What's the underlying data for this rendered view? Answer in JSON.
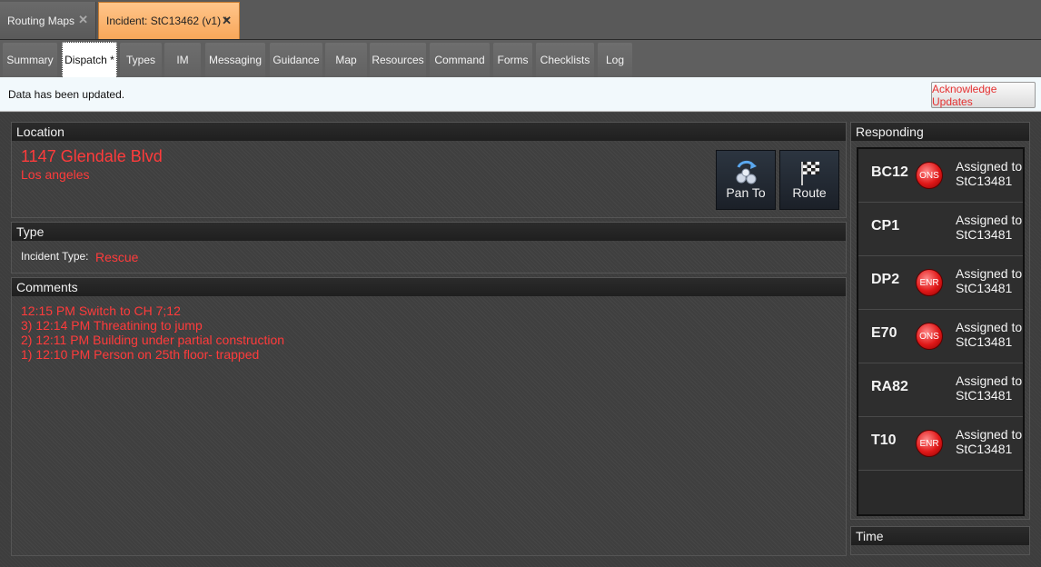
{
  "doc_tabs": [
    {
      "label": "Routing Maps"
    },
    {
      "label": "Incident: StC13462 (v1) *"
    }
  ],
  "sub_tabs": [
    {
      "label": "Summary"
    },
    {
      "label": "Dispatch *"
    },
    {
      "label": "Types"
    },
    {
      "label": "IM"
    },
    {
      "label": "Messaging"
    },
    {
      "label": "Guidance"
    },
    {
      "label": "Map"
    },
    {
      "label": "Resources"
    },
    {
      "label": "Command"
    },
    {
      "label": "Forms"
    },
    {
      "label": "Checklists"
    },
    {
      "label": "Log"
    }
  ],
  "notice": {
    "text": "Data has been updated.",
    "ack_label": "Acknowledge Updates"
  },
  "location": {
    "header": "Location",
    "street": "1147 Glendale Blvd",
    "city": "Los angeles",
    "pan_label": "Pan To",
    "route_label": "Route"
  },
  "type": {
    "header": "Type",
    "label": "Incident Type:",
    "value": "Rescue"
  },
  "comments": {
    "header": "Comments",
    "lines": [
      "12:15 PM Switch to CH 7;12",
      "3) 12:14 PM Threatining to jump",
      "2) 12:11 PM Building under partial construction",
      "1) 12:10 PM Person on 25th floor- trapped"
    ]
  },
  "responding": {
    "header": "Responding",
    "units": [
      {
        "unit": "BC12",
        "badge": "ONS",
        "status_line1": "Assigned to",
        "status_line2": "StC13481"
      },
      {
        "unit": "CP1",
        "badge": "",
        "status_line1": "Assigned to",
        "status_line2": "StC13481"
      },
      {
        "unit": "DP2",
        "badge": "ENR",
        "status_line1": "Assigned to",
        "status_line2": "StC13481"
      },
      {
        "unit": "E70",
        "badge": "ONS",
        "status_line1": "Assigned to",
        "status_line2": "StC13481"
      },
      {
        "unit": "RA82",
        "badge": "",
        "status_line1": "Assigned to",
        "status_line2": "StC13481"
      },
      {
        "unit": "T10",
        "badge": "ENR",
        "status_line1": "Assigned to",
        "status_line2": "StC13481"
      }
    ]
  },
  "time": {
    "header": "Time"
  },
  "colors": {
    "accent_red": "#ff3b3b",
    "active_tab_orange": "#f8a75a",
    "badge_red": "#e01818"
  },
  "icons": {
    "close": "close-icon",
    "pan": "pan-to-icon",
    "route": "checkered-flag-icon"
  }
}
